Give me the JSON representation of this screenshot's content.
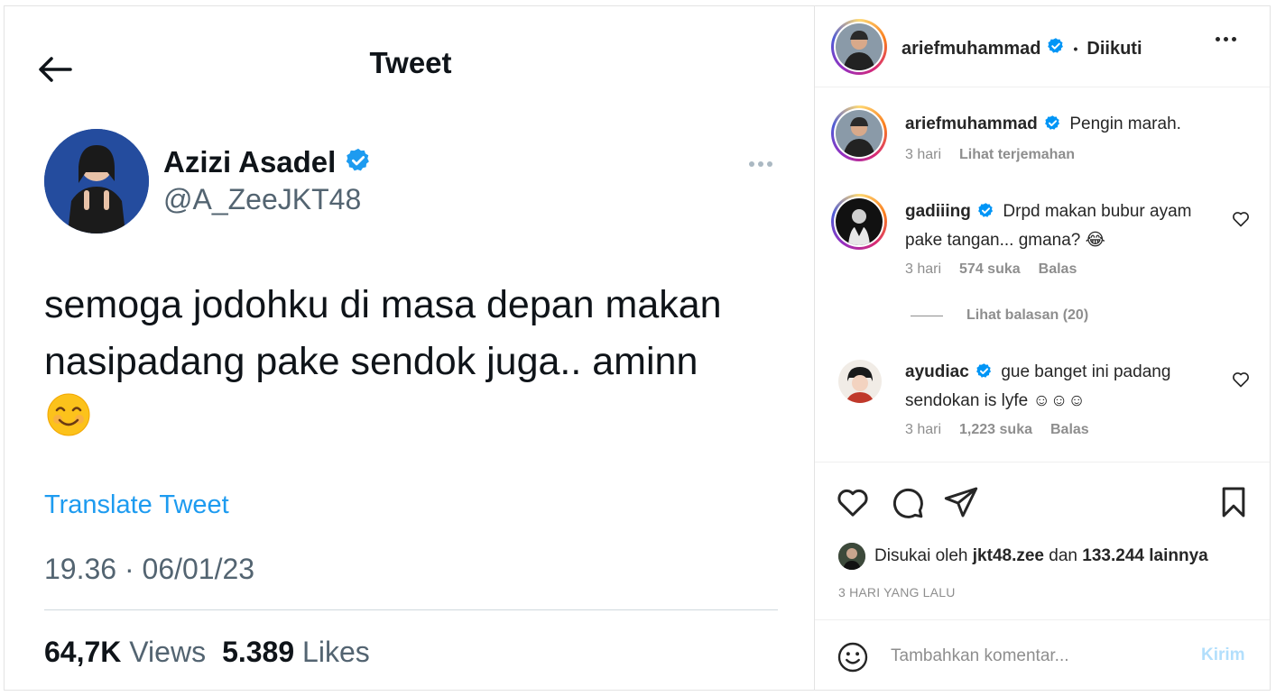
{
  "tweet": {
    "heading": "Tweet",
    "author_name": "Azizi Asadel",
    "handle": "@A_ZeeJKT48",
    "text": "semoga jodohku di masa depan makan nasipadang pake sendok juga.. aminn",
    "emoji": "smiling-face-emoji",
    "translate_label": "Translate Tweet",
    "timestamp": "19.36 · 06/01/23",
    "views_count": "64,7K",
    "views_label": "Views",
    "likes_count": "5.389",
    "likes_label": "Likes"
  },
  "instagram": {
    "header": {
      "username": "ariefmuhammad",
      "separator": "•",
      "follow_status": "Diikuti"
    },
    "comments": [
      {
        "username": "ariefmuhammad",
        "text": "Pengin marah.",
        "time": "3 hari",
        "action": "Lihat terjemahan"
      },
      {
        "username": "gadiiing",
        "text": "Drpd makan bubur ayam pake tangan... gmana? 😂",
        "time": "3 hari",
        "likes": "574 suka",
        "reply": "Balas"
      },
      {
        "username": "ayudiac",
        "text": "gue banget ini padang sendokan is lyfe ☺☺☺",
        "time": "3 hari",
        "likes": "1,223 suka",
        "reply": "Balas"
      }
    ],
    "view_replies": "Lihat balasan (20)",
    "liked_by": {
      "prefix": "Disukai oleh",
      "user": "jkt48.zee",
      "conj": "dan",
      "others": "133.244 lainnya"
    },
    "time_ago": "3 HARI YANG LALU",
    "add_comment": {
      "placeholder": "Tambahkan komentar...",
      "post_label": "Kirim"
    }
  },
  "colors": {
    "twitter_blue": "#1d9bf0",
    "verified_blue": "#0095f6",
    "muted_gray": "#536471",
    "ig_gray": "#8e8e8e"
  }
}
